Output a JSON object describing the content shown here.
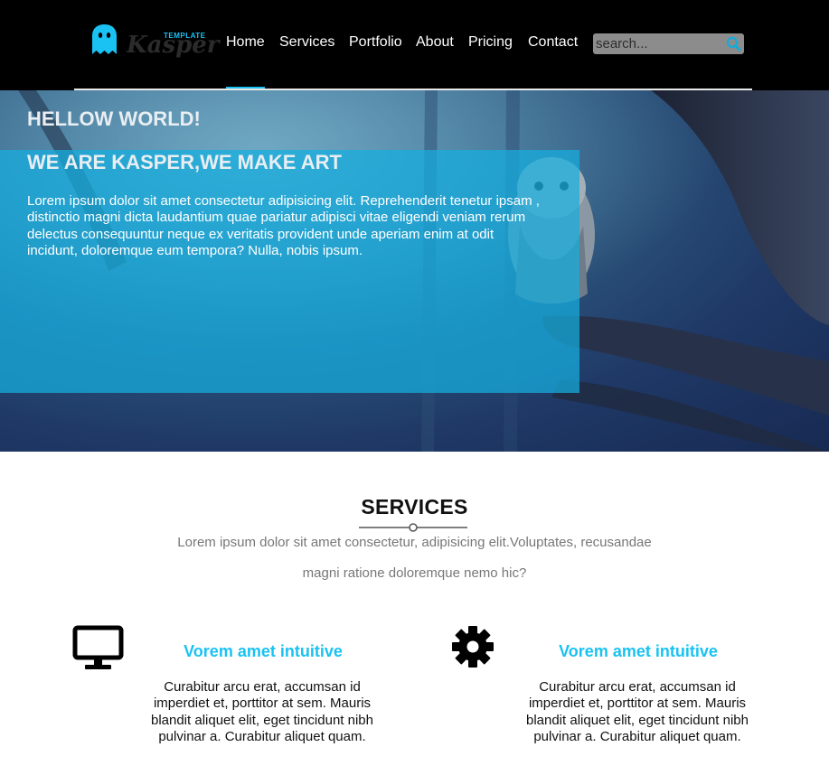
{
  "brand": {
    "small": "TEMPLATE",
    "name": "Kasper",
    "accent": "#19c2f2"
  },
  "nav": {
    "items": [
      "Home",
      "Services",
      "Portfolio",
      "About",
      "Pricing",
      "Contact"
    ],
    "active": "Home"
  },
  "search": {
    "placeholder": "search..."
  },
  "hero": {
    "heading1": "HELLOW WORLD!",
    "heading2": "WE ARE KASPER,WE MAKE ART",
    "text": "Lorem ipsum dolor sit amet consectetur adipisicing elit. Reprehenderit tenetur ipsam , distinctio magni dicta laudantium quae pariatur adipisci vitae eligendi veniam rerum delectus consequuntur neque ex veritatis provident unde aperiam enim at odit incidunt, doloremque eum tempora? Nulla, nobis ipsum.",
    "overlay_color": "#15afe1"
  },
  "services": {
    "title": "SERVICES",
    "subtitle_line1": "Lorem ipsum dolor sit amet consectetur, adipisicing elit.Voluptates, recusandae",
    "subtitle_line2": "magni ratione doloremque nemo hic?",
    "cards": [
      {
        "icon": "desktop-icon",
        "title": "Vorem amet intuitive",
        "text": "Curabitur arcu erat, accumsan id imperdiet et, porttitor at sem. Mauris blandit aliquet elit, eget tincidunt nibh pulvinar a. Curabitur aliquet quam."
      },
      {
        "icon": "gear-icon",
        "title": "Vorem amet intuitive",
        "text": "Curabitur arcu erat, accumsan id imperdiet et, porttitor at sem. Mauris blandit aliquet elit, eget tincidunt nibh pulvinar a. Curabitur aliquet quam."
      }
    ]
  }
}
